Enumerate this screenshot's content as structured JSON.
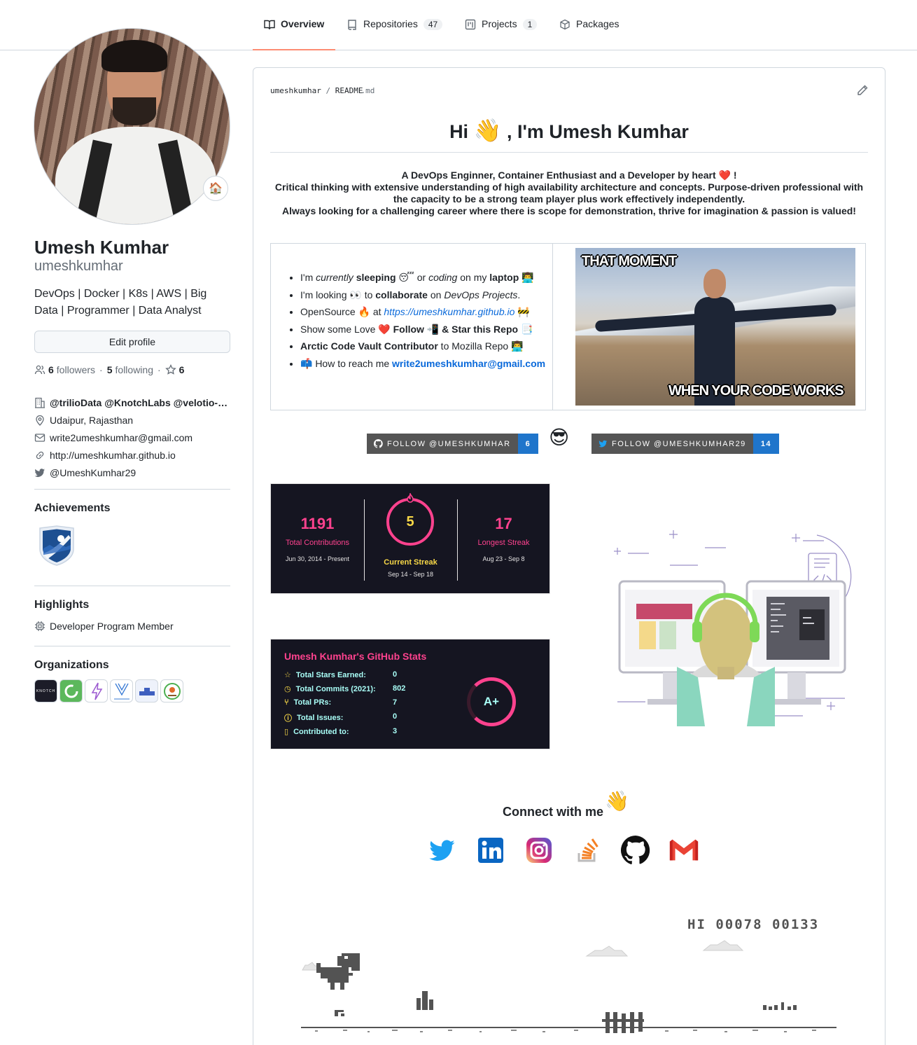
{
  "tabs": [
    {
      "label": "Overview",
      "icon": "book-icon",
      "active": true
    },
    {
      "label": "Repositories",
      "count": "47",
      "icon": "repo-icon"
    },
    {
      "label": "Projects",
      "count": "1",
      "icon": "project-icon"
    },
    {
      "label": "Packages",
      "icon": "package-icon"
    }
  ],
  "profile": {
    "status_emoji": "🏠",
    "name": "Umesh Kumhar",
    "login": "umeshkumhar",
    "bio": "DevOps | Docker | K8s | AWS | Big Data | Programmer | Data Analyst",
    "edit_label": "Edit profile",
    "followers_count": "6",
    "followers_label": "followers",
    "following_count": "5",
    "following_label": "following",
    "stars_count": "6",
    "sep": "·",
    "company": "@trilioData @KnotchLabs @velotio-…",
    "location": "Udaipur, Rajasthan",
    "email": "write2umeshkumhar@gmail.com",
    "website": "http://umeshkumhar.github.io",
    "twitter": "@UmeshKumhar29"
  },
  "achievements": {
    "heading": "Achievements",
    "badge": "arctic-code-vault-badge"
  },
  "highlights": {
    "heading": "Highlights",
    "item": "Developer Program Member"
  },
  "organizations": {
    "heading": "Organizations",
    "items": [
      {
        "name": "KNOTCH",
        "color": "#1c1c28"
      },
      {
        "name": "org-2",
        "color": "#5cb85c"
      },
      {
        "name": "org-3",
        "color": "#ffffff"
      },
      {
        "name": "VELOTIO",
        "color": "#ffffff"
      },
      {
        "name": "org-5",
        "color": "#eef2fb"
      },
      {
        "name": "org-6",
        "color": "#ffffff"
      }
    ]
  },
  "readme": {
    "path_owner": "umeshkumhar",
    "path_slash": "/",
    "path_file": "README",
    "path_ext": ".md",
    "greeting_pre": "Hi",
    "greeting_emoji": "👋",
    "greeting_post": ", I'm Umesh Kumhar",
    "intro_1": "A DevOps Enginner, Container Enthusiast and a Developer by heart",
    "intro_1_emoji": "❤️",
    "intro_1_end": "!",
    "intro_2": "Critical thinking with extensive understanding of high availability architecture and concepts. Purpose-driven professional with the capacity to be a strong team player plus work effectively independently.",
    "intro_3": "Always looking for a challenging career where there is scope for demonstration, thrive for imagination & passion is valued!",
    "bullets": {
      "b1": {
        "a": "I'm ",
        "b": "currently",
        "c": " ",
        "d": "sleeping",
        "e": " 😴 or ",
        "f": "coding",
        "g": " on my ",
        "h": "laptop",
        "i": " 👨‍💻"
      },
      "b2": {
        "a": "I'm looking 👀 to ",
        "b": "collaborate",
        "c": " on ",
        "d": "DevOps Projects",
        "e": "."
      },
      "b3": {
        "a": "OpenSource 🔥 at ",
        "link": "https://umeshkumhar.github.io",
        "e": " 🚧"
      },
      "b4": {
        "a": "Show some Love ❤️ ",
        "b": "Follow",
        "c": " 📲 ",
        "d": "& Star this Repo",
        "e": " 📑"
      },
      "b5": {
        "a": "Arctic Code Vault Contributor",
        "b": " to Mozilla Repo 👨‍💻"
      },
      "b6": {
        "a": "📫 How to reach me ",
        "link": "write2umeshkumhar@gmail.com"
      }
    },
    "meme_top": "THAT MOMENT",
    "meme_bottom": "WHEN YOUR CODE WORKS",
    "follow_github": {
      "label": "FOLLOW @UMESHKUMHAR",
      "count": "6"
    },
    "cool_emoji": "😎",
    "follow_twitter": {
      "label": "FOLLOW @UMESHKUMHAR29",
      "count": "14"
    },
    "streak": {
      "total": "1191",
      "total_label": "Total Contributions",
      "total_range": "Jun 30, 2014 - Present",
      "current": "5",
      "current_label": "Current Streak",
      "current_range": "Sep 14 - Sep 18",
      "longest": "17",
      "longest_label": "Longest Streak",
      "longest_range": "Aug 23 - Sep 8"
    },
    "stats": {
      "title": "Umesh Kumhar's GitHub Stats",
      "rows": [
        {
          "label": "Total Stars Earned:",
          "value": "0",
          "icon": "star-icon"
        },
        {
          "label": "Total Commits (2021):",
          "value": "802",
          "icon": "clock-icon"
        },
        {
          "label": "Total PRs:",
          "value": "7",
          "icon": "pr-icon"
        },
        {
          "label": "Total Issues:",
          "value": "0",
          "icon": "issue-icon"
        },
        {
          "label": "Contributed to:",
          "value": "3",
          "icon": "repo-icon"
        }
      ],
      "grade": "A+"
    },
    "connect": "Connect with me",
    "connect_emoji": "👋",
    "socials": [
      "twitter-icon",
      "linkedin-icon",
      "instagram-icon",
      "stackoverflow-icon",
      "github-icon",
      "gmail-icon"
    ],
    "dino_score": "HI 00078  00133"
  },
  "colors": {
    "accent": "#fd8c73",
    "link": "#0969da",
    "stat_pink": "#fe428e",
    "stat_cyan": "#a9fef7",
    "badge_blue": "#1f75cb"
  }
}
